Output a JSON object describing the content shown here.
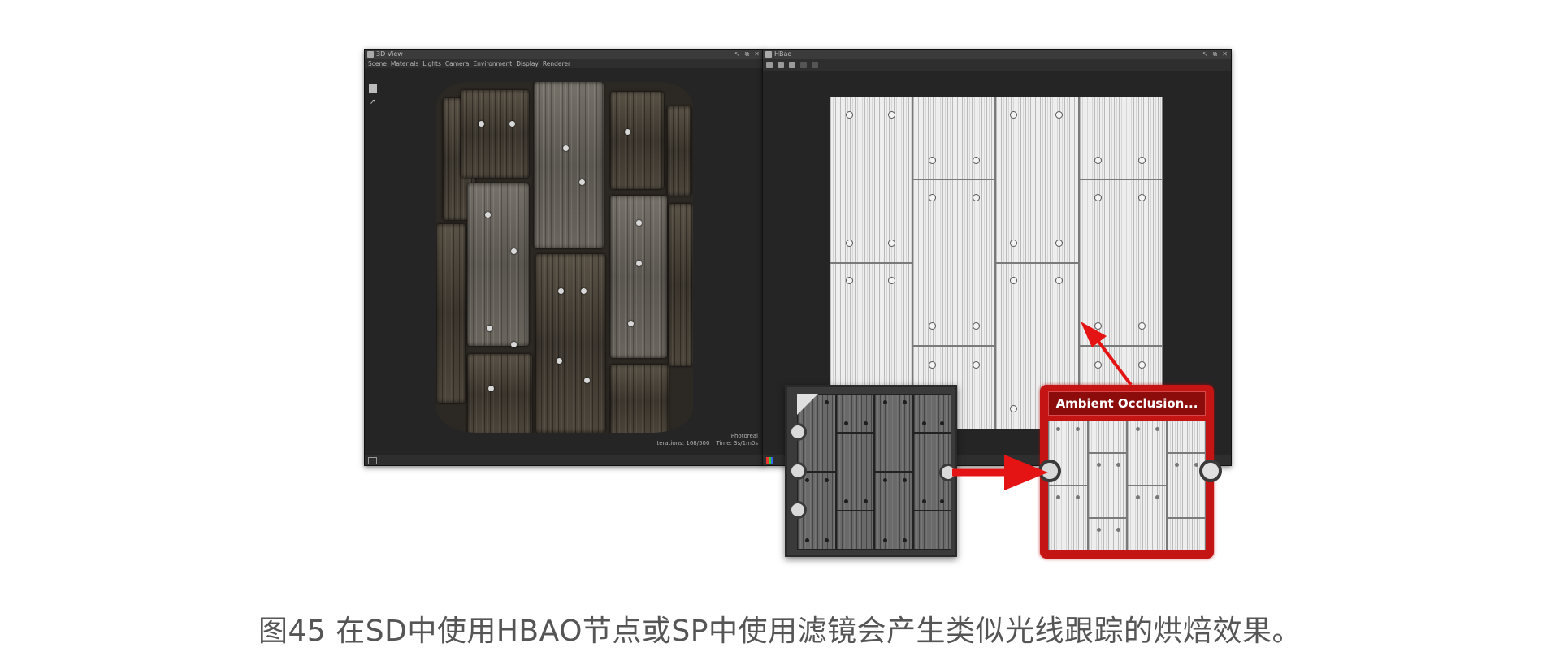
{
  "view3d": {
    "title": "3D View",
    "menu": [
      "Scene",
      "Materials",
      "Lights",
      "Camera",
      "Environment",
      "Display",
      "Renderer"
    ],
    "render_mode": "Photoreal",
    "iterations": "Iterations: 168/500",
    "time": "Time: 3s/1m0s"
  },
  "hbao_view": {
    "title": "HBao",
    "toolbar_icons": [
      "copy-icon",
      "save-icon",
      "export-icon",
      "undo-icon",
      "redo-icon"
    ]
  },
  "node_hbao": {
    "input_count": 3,
    "output_count": 1
  },
  "node_ao": {
    "title": "Ambient Occlusion...",
    "accent_color": "#b01010"
  },
  "colors": {
    "arrow": "#e51414",
    "panel_bg": "#252525",
    "caption": "#555555"
  },
  "caption": "图45 在SD中使用HBAO节点或SP中使用滤镜会产生类似光线跟踪的烘焙效果。"
}
